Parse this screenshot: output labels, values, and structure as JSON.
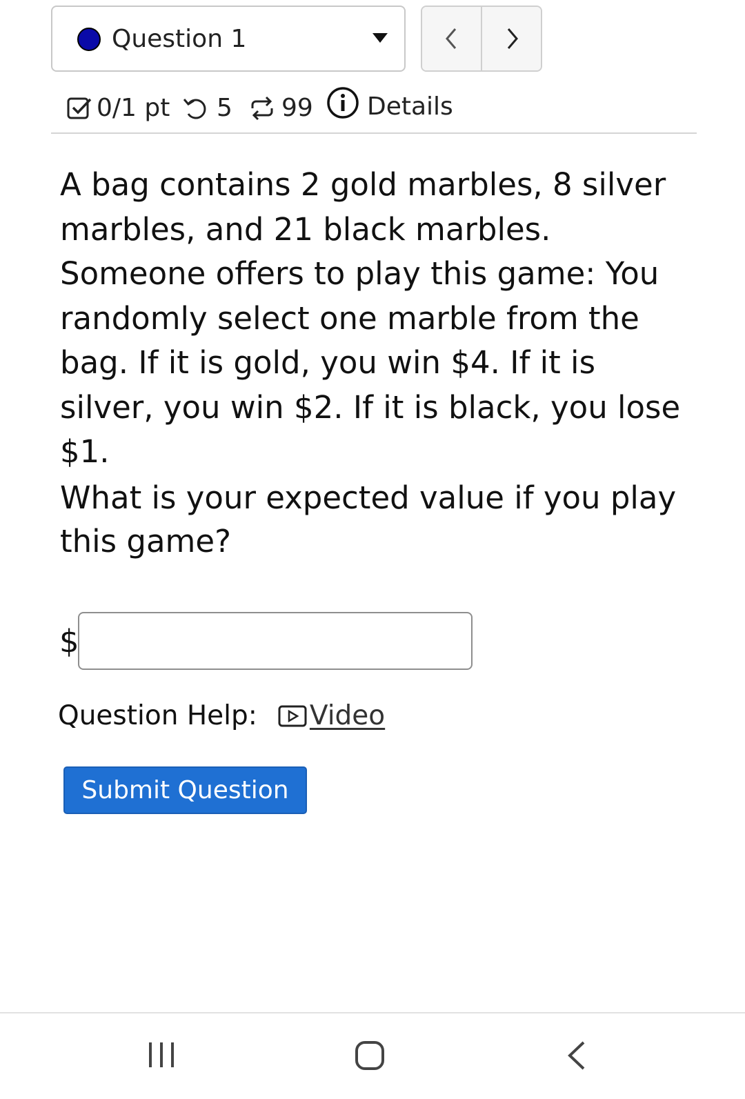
{
  "header": {
    "question_select": "Question 1",
    "prev_label": "‹",
    "next_label": "›"
  },
  "meta": {
    "points": "0/1 pt",
    "retries": "5",
    "attempts": "99",
    "details": "Details"
  },
  "question": {
    "body": "A bag contains 2 gold marbles, 8 silver marbles, and 21 black marbles. Someone offers to play this game: You randomly select one marble from the bag. If it is gold, you win $4. If it is silver, you win $2. If it is black, you lose $1.",
    "prompt": "What is your expected value if you play this game?",
    "answer_prefix": "$",
    "answer_value": ""
  },
  "help": {
    "label": "Question Help:",
    "video": "Video"
  },
  "submit": {
    "label": "Submit Question"
  },
  "colors": {
    "accent": "#1f70d3",
    "status_dot": "#0a0aa8"
  }
}
